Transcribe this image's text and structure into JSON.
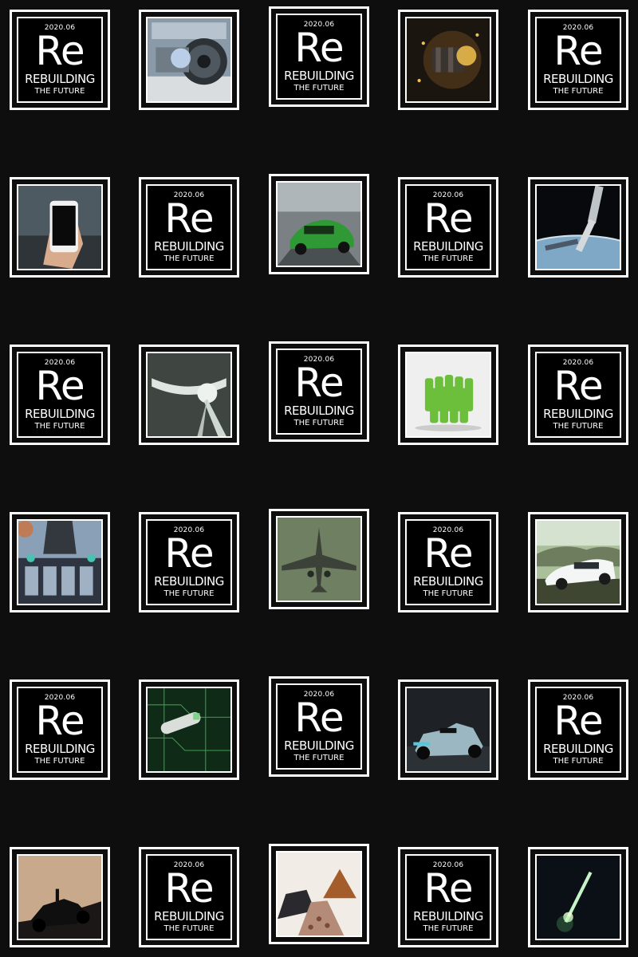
{
  "logo": {
    "date": "2020.06",
    "symbol": "Re",
    "word": "REBUILDING",
    "tagline": "THE FUTURE"
  },
  "tiles": [
    {
      "kind": "logo"
    },
    {
      "kind": "photo",
      "subject": "jet-engine-maintenance"
    },
    {
      "kind": "logo"
    },
    {
      "kind": "photo",
      "subject": "exploding-cylinder-cell"
    },
    {
      "kind": "logo"
    },
    {
      "kind": "photo",
      "subject": "hand-holding-smartphone"
    },
    {
      "kind": "logo"
    },
    {
      "kind": "photo",
      "subject": "green-sports-car"
    },
    {
      "kind": "logo"
    },
    {
      "kind": "photo",
      "subject": "robotic-arm-over-earth"
    },
    {
      "kind": "logo"
    },
    {
      "kind": "photo",
      "subject": "wind-turbine-hub"
    },
    {
      "kind": "logo"
    },
    {
      "kind": "photo",
      "subject": "green-battery-cells"
    },
    {
      "kind": "logo"
    },
    {
      "kind": "photo",
      "subject": "battery-module-assembly"
    },
    {
      "kind": "logo"
    },
    {
      "kind": "photo",
      "subject": "fighter-jet"
    },
    {
      "kind": "logo"
    },
    {
      "kind": "photo",
      "subject": "white-electric-car"
    },
    {
      "kind": "logo"
    },
    {
      "kind": "photo",
      "subject": "circuit-board-battery"
    },
    {
      "kind": "logo"
    },
    {
      "kind": "photo",
      "subject": "formula-e-racecar"
    },
    {
      "kind": "logo"
    },
    {
      "kind": "photo",
      "subject": "formula-car-silhouette"
    },
    {
      "kind": "logo"
    },
    {
      "kind": "photo",
      "subject": "raw-minerals-pile"
    },
    {
      "kind": "logo"
    },
    {
      "kind": "photo",
      "subject": "rocket-launch-night"
    }
  ]
}
